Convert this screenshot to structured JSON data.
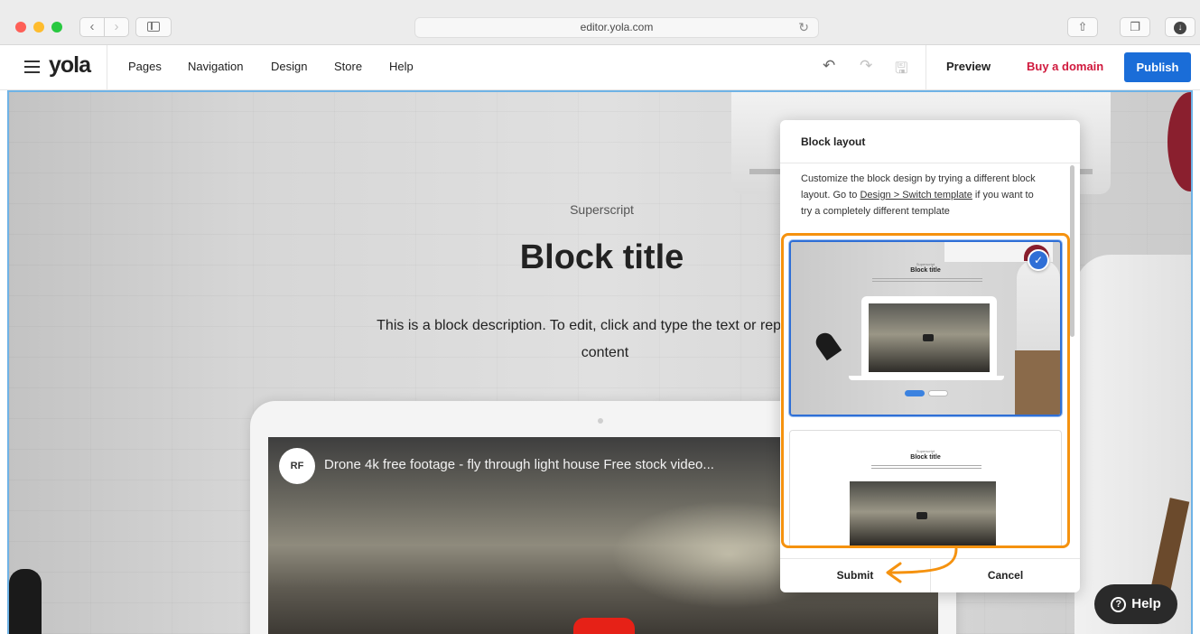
{
  "browser": {
    "url": "editor.yola.com",
    "back_glyph": "‹",
    "forward_glyph": "›",
    "reload_glyph": "↻",
    "share_glyph": "⇧",
    "tabs_glyph": "❐",
    "download_glyph": "↓"
  },
  "editor": {
    "logo": "yola",
    "menu": [
      "Pages",
      "Navigation",
      "Design",
      "Store",
      "Help"
    ],
    "undo_glyph": "↶",
    "redo_glyph": "↷",
    "save_glyph": "🖫",
    "preview_label": "Preview",
    "buy_domain_label": "Buy a domain",
    "publish_label": "Publish",
    "accent_color": "#1a6dd8",
    "domain_color": "#d0193d"
  },
  "block": {
    "superscript": "Superscript",
    "title": "Block title",
    "description": "This is a block description. To edit, click and type the text or replace it w",
    "description_line2": "content"
  },
  "video": {
    "channel_badge": "RF",
    "title": "Drone 4k free footage - fly through light house Free stock video..."
  },
  "panel": {
    "title": "Block layout",
    "description_before": "Customize the block design by trying a different block layout. Go to ",
    "link": "Design > Switch template",
    "description_after": " if you want to try a completely different template",
    "thumb_superscript": "Superscript",
    "thumb_title": "Block title",
    "check_glyph": "✓",
    "submit_label": "Submit",
    "cancel_label": "Cancel",
    "highlight_color": "#f5920f"
  },
  "help": {
    "icon_glyph": "?",
    "label": "Help"
  }
}
